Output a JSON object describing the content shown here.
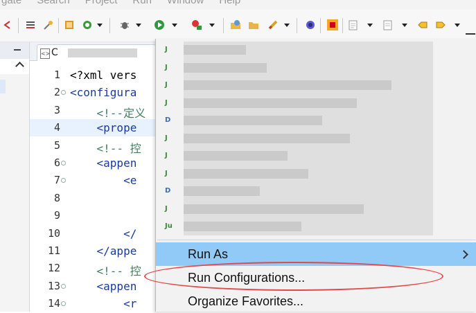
{
  "menubar": {
    "items": [
      "gate",
      "Search",
      "Project",
      "Run",
      "Window",
      "Help"
    ]
  },
  "toolbar": {
    "icons": [
      "back-icon",
      "outline-icon",
      "tools-icon",
      "build-icon",
      "web-icon",
      "debug-icon",
      "run-icon",
      "external-tools-icon",
      "open-type-icon",
      "open-folder-icon",
      "rocket-icon",
      "circle-icon",
      "stop-icon",
      "edit-icon",
      "save-icon",
      "prev-icon",
      "next-icon"
    ]
  },
  "editor": {
    "tab_title": "C",
    "lines": [
      {
        "num": "1",
        "parts": [
          [
            "plain",
            "<?xml vers"
          ]
        ]
      },
      {
        "num": "2",
        "parts": [
          [
            "tag",
            "<configura"
          ]
        ],
        "fold": true
      },
      {
        "num": "3",
        "parts": [
          [
            "comment",
            "    <!--定义"
          ]
        ]
      },
      {
        "num": "4",
        "parts": [
          [
            "tag",
            "    <prope"
          ]
        ],
        "highlight": true
      },
      {
        "num": "5",
        "parts": [
          [
            "comment",
            "    <!-- 控"
          ]
        ]
      },
      {
        "num": "6",
        "parts": [
          [
            "tag",
            "    <appen"
          ]
        ],
        "fold": true
      },
      {
        "num": "7",
        "parts": [
          [
            "tag",
            "        <e"
          ]
        ],
        "fold": true
      },
      {
        "num": "8",
        "parts": [
          [
            "plain",
            ""
          ]
        ]
      },
      {
        "num": "9",
        "parts": [
          [
            "plain",
            ""
          ]
        ]
      },
      {
        "num": "10",
        "parts": [
          [
            "tag",
            "        </"
          ]
        ]
      },
      {
        "num": "11",
        "parts": [
          [
            "tag",
            "    </appe"
          ]
        ]
      },
      {
        "num": "12",
        "parts": [
          [
            "comment",
            "    <!-- 控"
          ]
        ]
      },
      {
        "num": "13",
        "parts": [
          [
            "tag",
            "    <appen"
          ]
        ],
        "fold": true
      },
      {
        "num": "14",
        "parts": [
          [
            "tag",
            "        <r"
          ]
        ],
        "fold": true
      }
    ]
  },
  "context_menu": {
    "favorites": [
      {
        "icon": "junit-launch-icon",
        "glyph": "J"
      },
      {
        "icon": "junit-test-icon",
        "glyph": "J"
      },
      {
        "icon": "junit-test-icon",
        "glyph": "J"
      },
      {
        "icon": "app-launch-icon",
        "glyph": "J"
      },
      {
        "icon": "app-launch-icon",
        "glyph": "D"
      },
      {
        "icon": "junit-test-icon",
        "glyph": "J"
      },
      {
        "icon": "junit-test-icon",
        "glyph": "J"
      },
      {
        "icon": "junit-test-icon",
        "glyph": "J"
      },
      {
        "icon": "app-launch-icon",
        "glyph": "D"
      },
      {
        "icon": "junit-test-icon",
        "glyph": "J"
      },
      {
        "icon": "junit-test-icon",
        "glyph": "Ju"
      }
    ],
    "run_as": "Run As",
    "run_configurations": "Run Configurations...",
    "organize_favorites": "Organize Favorites..."
  },
  "colors": {
    "menu_highlight": "#91c9f7",
    "annotation_ellipse": "#e4484a",
    "xml_tag": "#1b3a9e",
    "xml_comment": "#3f7f5f"
  }
}
